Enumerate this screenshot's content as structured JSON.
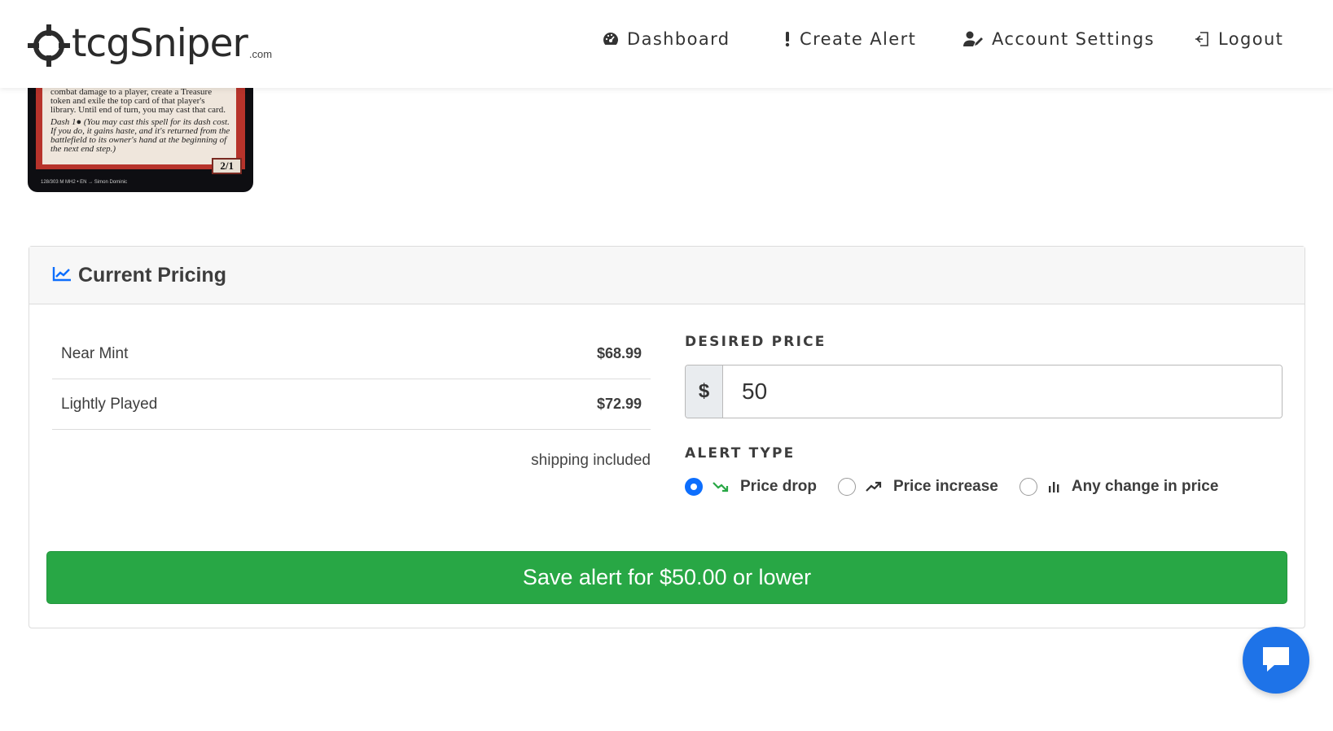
{
  "brand": {
    "name": "tcgSniper",
    "suffix": ".com"
  },
  "nav": {
    "dashboard": "Dashboard",
    "create_alert": "Create Alert",
    "account_settings": "Account Settings",
    "logout": "Logout"
  },
  "card": {
    "rules_text": "combat damage to a player, create a Treasure token and exile the top card of that player's library. Until end of turn, you may cast that card.",
    "dash_text": "Dash 1● (You may cast this spell for its dash cost. If you do, it gains haste, and it's returned from the battlefield to its owner's hand at the beginning of the next end step.)",
    "power_toughness": "2/1",
    "footer_left": "128/303 M  MH2 • EN → Simon Dominic",
    "footer_right": "™ & © 2021 Wizards of the Coast"
  },
  "pricing": {
    "title": "Current Pricing",
    "rows": [
      {
        "condition": "Near Mint",
        "price": "$68.99"
      },
      {
        "condition": "Lightly Played",
        "price": "$72.99"
      }
    ],
    "shipping_note": "shipping included"
  },
  "alert_form": {
    "desired_price_label": "DESIRED PRICE",
    "currency_symbol": "$",
    "desired_price_value": "50",
    "alert_type_label": "ALERT TYPE",
    "options": [
      {
        "label": "Price drop",
        "selected": true,
        "icon": "trend-down-icon"
      },
      {
        "label": "Price increase",
        "selected": false,
        "icon": "trend-up-icon"
      },
      {
        "label": "Any change in price",
        "selected": false,
        "icon": "bar-chart-icon"
      }
    ],
    "save_label": "Save alert for $50.00 or lower"
  },
  "colors": {
    "accent": "#0d6efd",
    "success": "#28a745",
    "chat": "#1e73e8",
    "card_frame": "#b7332b"
  }
}
